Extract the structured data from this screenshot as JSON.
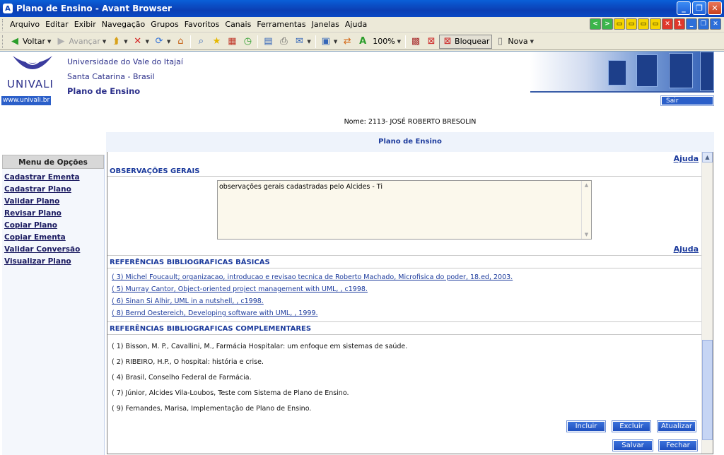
{
  "window": {
    "title": "Plano de Ensino - Avant Browser"
  },
  "menubar": {
    "items": [
      "Arquivo",
      "Editar",
      "Exibir",
      "Navegação",
      "Grupos",
      "Favoritos",
      "Canais",
      "Ferramentas",
      "Janelas",
      "Ajuda"
    ]
  },
  "mdi_buttons": [
    "<",
    ">",
    "▭",
    "▭",
    "▭",
    "▭",
    "✕",
    "1",
    "_",
    "❐",
    "✕"
  ],
  "toolbar": {
    "back_label": "Voltar",
    "forward_label": "Avançar",
    "zoom": "100%",
    "block_label": "Bloquear",
    "new_label": "Nova"
  },
  "header": {
    "logo_text": "UNIVALI",
    "university": "Universidade do Vale do Itajaí",
    "location": "Santa Catarina - Brasil",
    "system": "Plano de Ensino",
    "site_link": "www.univali.br",
    "exit_label": "Sair"
  },
  "user": {
    "name": "Nome: 2113- JOSÉ ROBERTO BRESOLIN"
  },
  "section_title": "Plano de Ensino",
  "left_menu": {
    "title": "Menu de Opções",
    "items": [
      "Cadastrar Ementa",
      "Cadastrar Plano",
      "Validar Plano",
      "Revisar Plano",
      "Copiar Plano",
      "Copiar Ementa",
      "Validar Conversão",
      "Visualizar Plano"
    ]
  },
  "content": {
    "help_label": "Ajuda",
    "obs_title": "OBSERVAÇÕES GERAIS",
    "obs_text": "observações gerais cadastradas pelo Alcides - Ti",
    "basic_title": "REFERÊNCIAS BIBLIOGRAFICAS BÁSICAS",
    "basic_refs": [
      "( 3) Michel Foucault; organizacao, introducao e revisao tecnica de Roberto Machado, Microfisica do poder, 18.ed, 2003.",
      "( 5) Murray Cantor, Object-oriented project management with UML, , c1998.",
      "( 6) Sinan Si Alhir, UML in a nutshell, , c1998.",
      "( 8) Bernd Oestereich, Developing software with UML, , 1999."
    ],
    "compl_title": "REFERÊNCIAS BIBLIOGRAFICAS COMPLEMENTARES",
    "compl_refs": [
      "( 1) Bisson, M. P., Cavallini, M., Farmácia Hospitalar: um enfoque em sistemas de saúde.",
      "( 2) RIBEIRO, H.P., O hospital: história e crise.",
      "( 4) Brasil, Conselho Federal de Farmácia.",
      "( 7) Júnior, Alcides Vila-Loubos, Teste com Sistema de Plano de Ensino.",
      "( 9) Fernandes, Marisa, Implementação de Plano de Ensino."
    ],
    "buttons": {
      "include": "Incluir",
      "delete": "Excluir",
      "update": "Atualizar",
      "save": "Salvar",
      "close": "Fechar"
    }
  },
  "colors": {
    "link": "#1b3a9c",
    "button": "#1e4fbf",
    "titlebar": "#0b3fb4"
  }
}
